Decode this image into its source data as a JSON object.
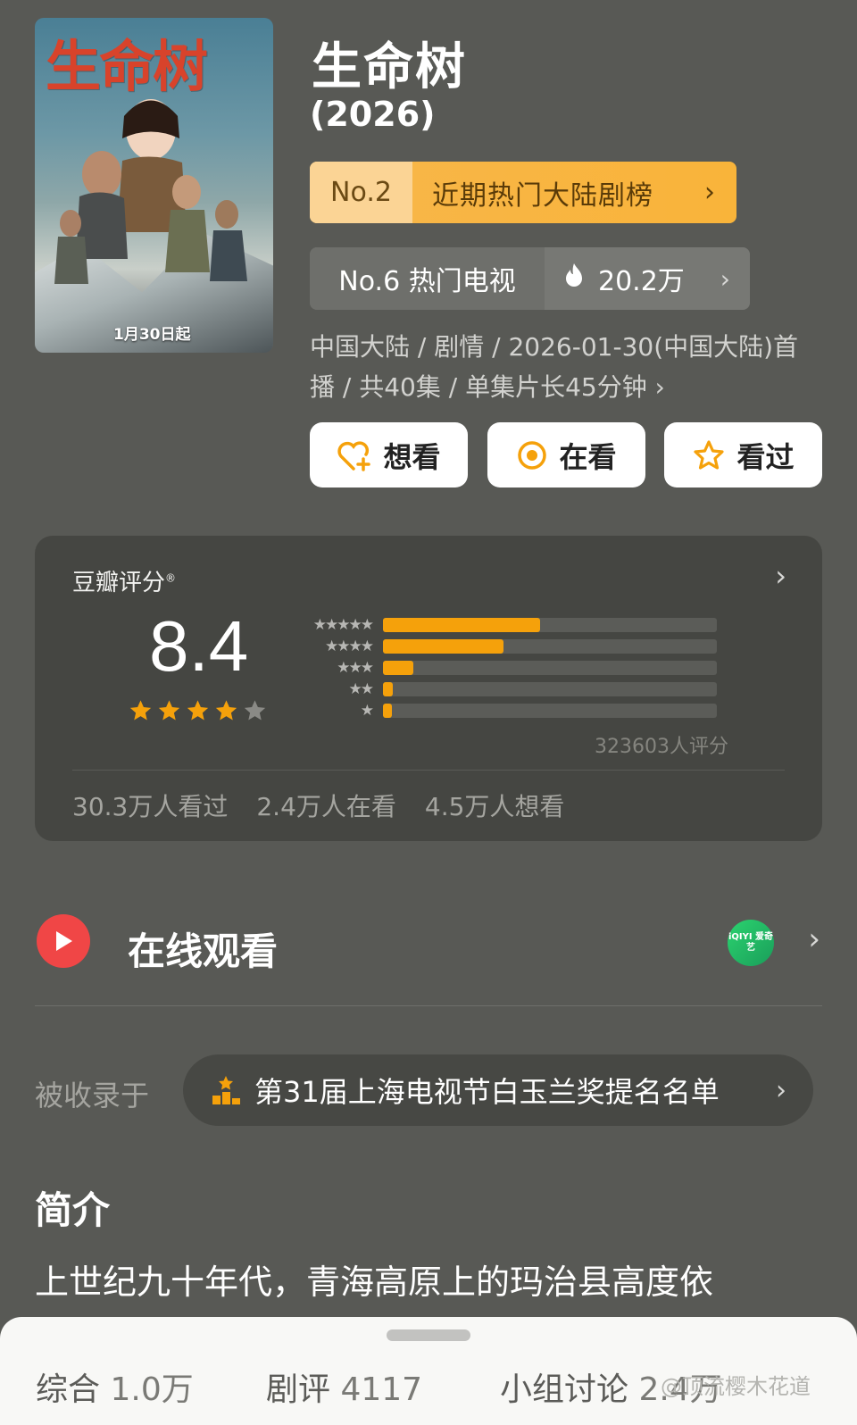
{
  "poster": {
    "title": "生命树",
    "date": "1月30日起"
  },
  "title": "生命树",
  "year": "(2026)",
  "rank": {
    "number": "No.2",
    "name": "近期热门大陆剧榜",
    "chevron": "›"
  },
  "hot": {
    "label": "No.6 热门电视",
    "count": "20.2万",
    "chevron": "›"
  },
  "meta": "中国大陆 / 剧情 / 2026-01-30(中国大陆)首播 / 共40集 / 单集片长45分钟 ›",
  "actions": [
    {
      "label": "想看",
      "icon": "heart-plus-icon"
    },
    {
      "label": "在看",
      "icon": "eye-circle-icon"
    },
    {
      "label": "看过",
      "icon": "star-outline-icon"
    }
  ],
  "rating": {
    "source": "豆瓣评分",
    "mark": "®",
    "score": "8.4",
    "stars_filled": 4,
    "distribution": [
      {
        "stars": "★★★★★",
        "fraction": 0.47
      },
      {
        "stars": "★★★★",
        "fraction": 0.36
      },
      {
        "stars": "★★★",
        "fraction": 0.09
      },
      {
        "stars": "★★",
        "fraction": 0.03
      },
      {
        "stars": "★",
        "fraction": 0.02
      }
    ],
    "votes": "323603人评分",
    "stats": [
      "30.3万人看过",
      "2.4万人在看",
      "4.5万人想看"
    ]
  },
  "watch": {
    "label": "在线观看",
    "provider": "iQIYI 爱奇艺"
  },
  "included": {
    "label": "被收录于",
    "list": "第31届上海电视节白玉兰奖提名名单"
  },
  "intro": {
    "title": "简介",
    "text": "上世纪九十年代，青海高原上的玛治县高度依"
  },
  "bottom_tabs": [
    {
      "label": "综合",
      "count": "1.0万"
    },
    {
      "label": "剧评",
      "count": "4117"
    },
    {
      "label": "小组讨论",
      "count": "2.4万"
    }
  ],
  "watermark": "@顶流樱木花道",
  "colors": {
    "background": "#585955",
    "accent_orange": "#f5a10b",
    "play_red": "#f04646",
    "card": "#454642"
  }
}
